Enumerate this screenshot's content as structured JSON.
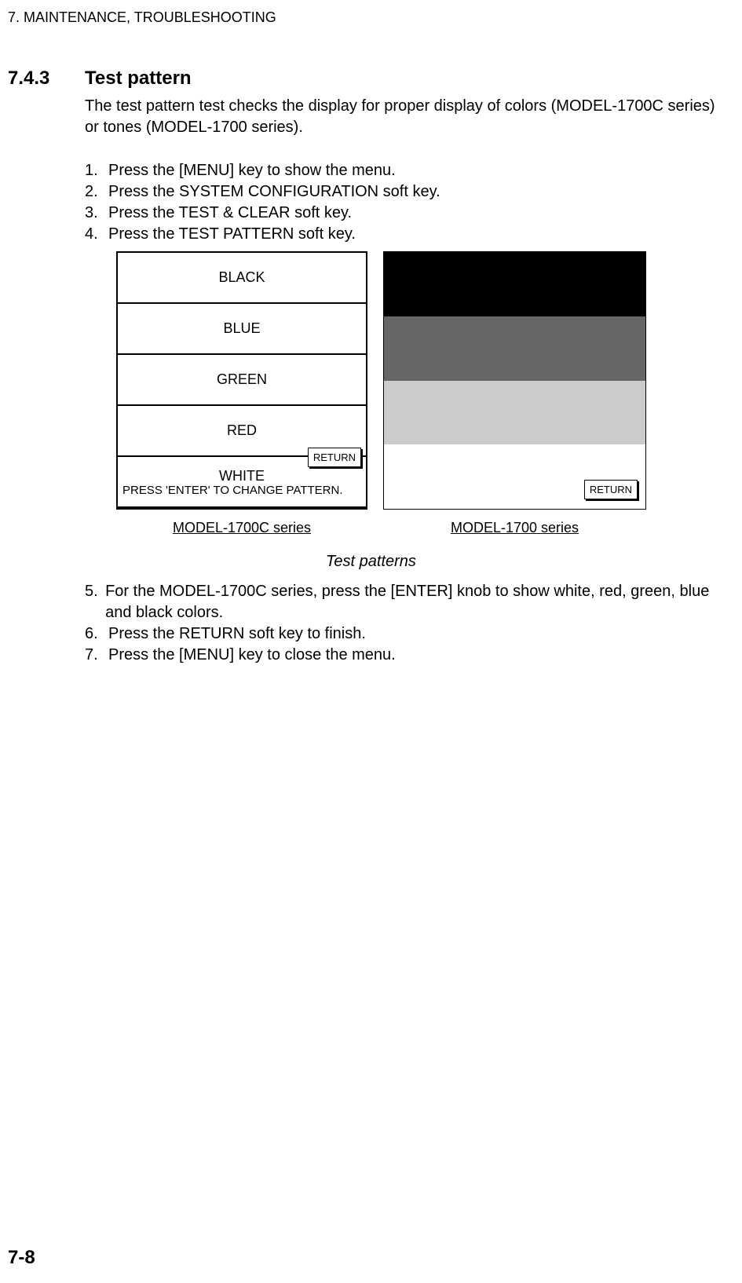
{
  "header": "7. MAINTENANCE, TROUBLESHOOTING",
  "section_number": "7.4.3",
  "section_title": "Test pattern",
  "intro": "The test pattern test checks the display for proper display of colors (MODEL-1700C series) or tones (MODEL-1700 series).",
  "steps1": [
    {
      "num": "1.",
      "text": "Press the [MENU] key to show the menu."
    },
    {
      "num": "2.",
      "text": "Press the SYSTEM CONFIGURATION soft key."
    },
    {
      "num": "3.",
      "text": "Press the TEST & CLEAR soft key."
    },
    {
      "num": "4.",
      "text": "Press the TEST PATTERN soft key."
    }
  ],
  "panel_left": {
    "rows": [
      "BLACK",
      "BLUE",
      "GREEN",
      "RED",
      "WHITE"
    ],
    "enter_text": "PRESS 'ENTER' TO CHANGE PATTERN.",
    "return": "RETURN"
  },
  "panel_right": {
    "return": "RETURN"
  },
  "model_left": "MODEL-1700C series",
  "model_right": "MODEL-1700 series",
  "figure_caption": "Test patterns",
  "steps2": [
    {
      "num": "5.",
      "text": "For the MODEL-1700C series, press the [ENTER] knob to show white, red, green, blue and black colors."
    },
    {
      "num": "6.",
      "text": "Press the RETURN soft key to finish."
    },
    {
      "num": "7.",
      "text": "Press the [MENU] key to close the menu."
    }
  ],
  "page_number": "7-8"
}
